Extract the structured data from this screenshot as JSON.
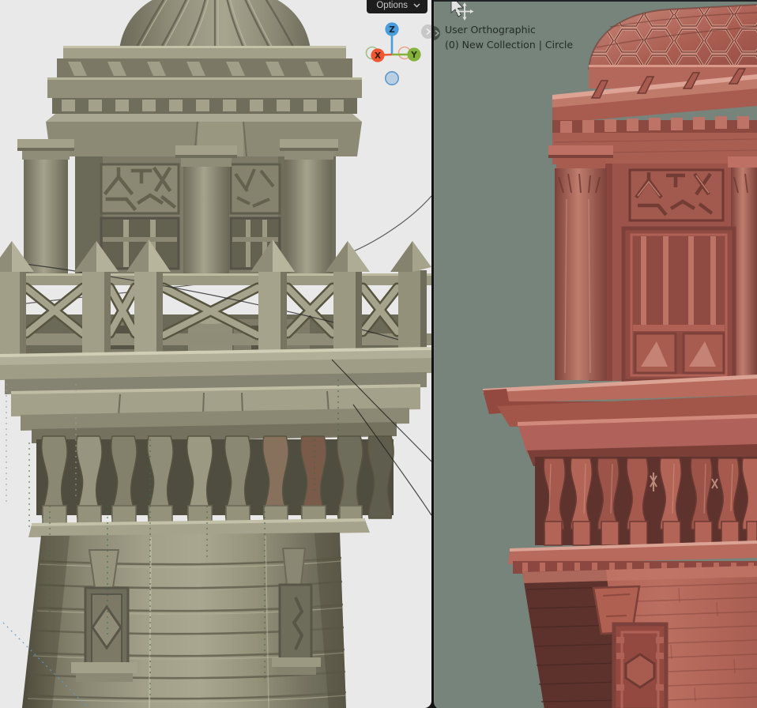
{
  "left_viewport": {
    "options_button": {
      "label": "Options"
    },
    "gizmo": {
      "z": "Z",
      "x": "X",
      "y": "Y"
    }
  },
  "right_viewport": {
    "overlay": {
      "line1": "User Orthographic",
      "line2": "(0) New Collection | Circle"
    }
  },
  "colors": {
    "page_bg": "#141414",
    "left_viewport_bg": "#e9e9e9",
    "right_viewport_bg": "#76847b",
    "options_button_bg": "#1d1d1d",
    "options_button_text": "#c9c9c9",
    "overlay_text": "#242c26",
    "axis_x": "#f15633",
    "axis_y": "#85b23b",
    "axis_z": "#4a9ddd",
    "axis_neg_z_fill": "#b9cfe3",
    "axis_neg_z_stroke": "#5e99cc",
    "axis_neg_x_stroke": "#f0a58d",
    "axis_neg_y_stroke": "#a3bd86",
    "model_left_clay": "#8f8d78",
    "model_right_clay": "#b0655a",
    "cursor_color": "#e2e2e2"
  }
}
